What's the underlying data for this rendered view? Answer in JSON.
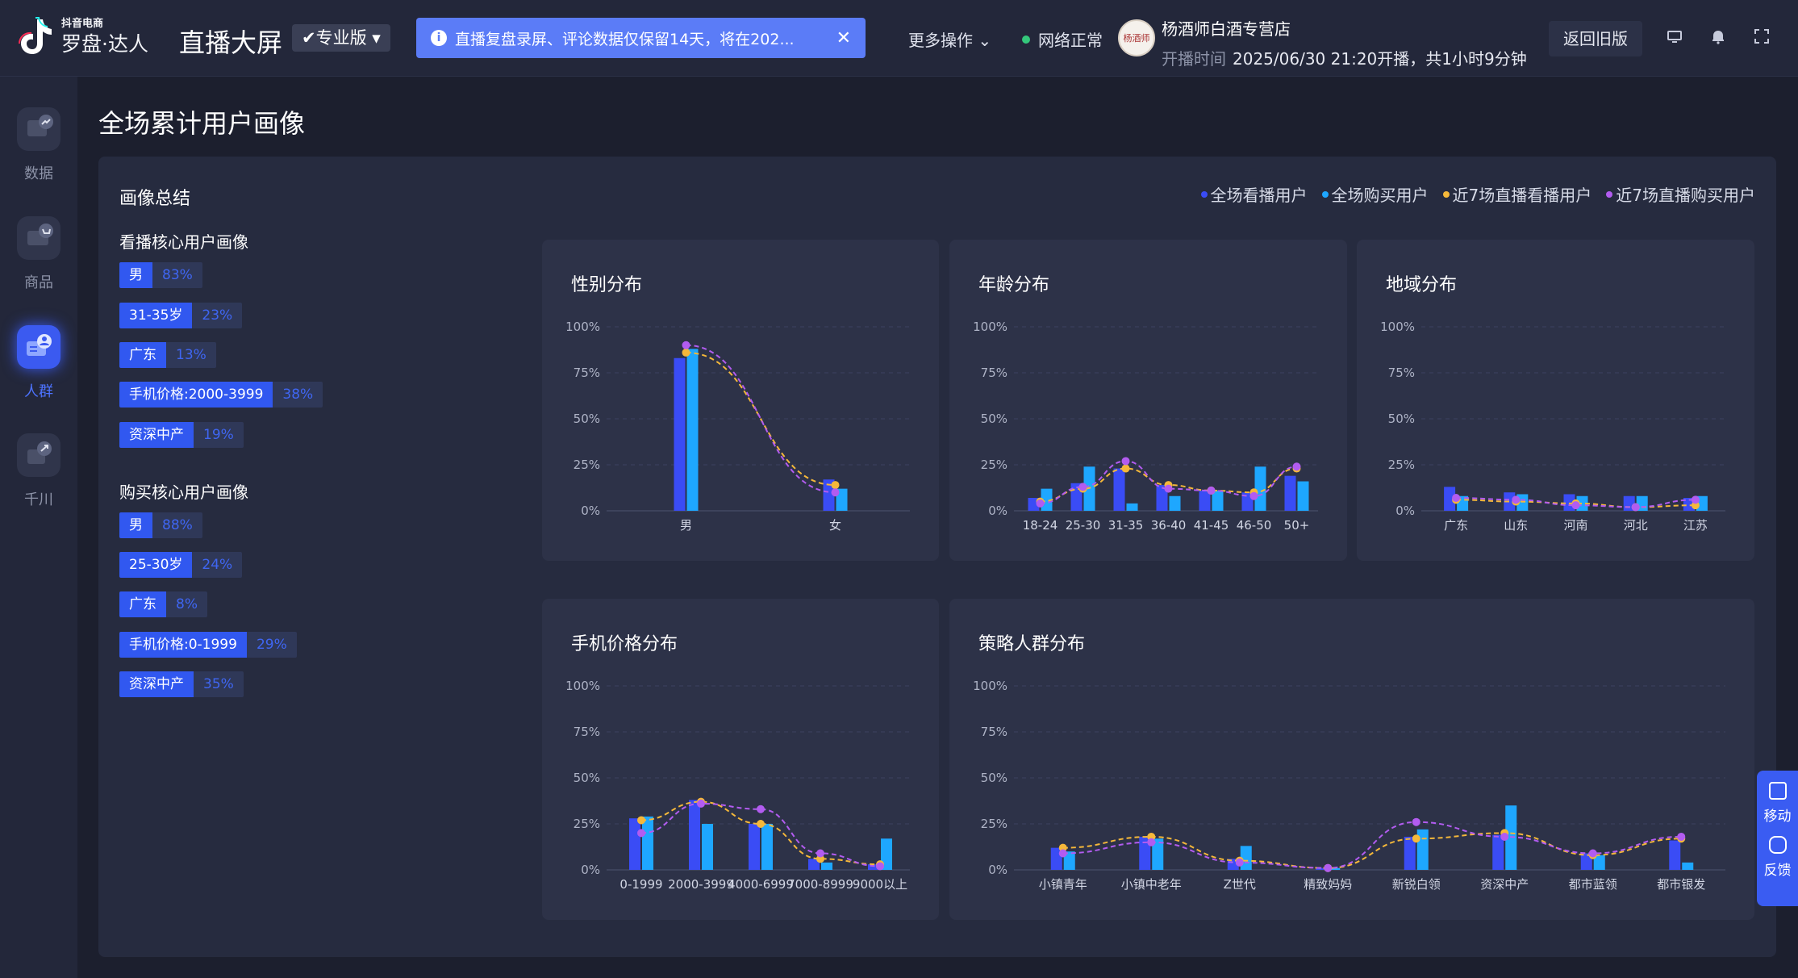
{
  "header": {
    "logo_small": "抖音电商",
    "logo_big": "罗盘·达人",
    "screen_title": "直播大屏",
    "edition": "专业版",
    "notice": "直播复盘录屏、评论数据仅保留14天，将在202...",
    "more_ops": "更多操作",
    "network_status": "网络正常",
    "store_name": "杨酒师白酒专营店",
    "start_label": "开播时间",
    "start_value": "2025/06/30 21:20开播，共1小时9分钟",
    "back_button": "返回旧版",
    "icons": [
      "monitor-icon",
      "bell-icon",
      "fullscreen-icon"
    ]
  },
  "nav": {
    "items": [
      {
        "label": "数据",
        "icon": "data-icon"
      },
      {
        "label": "商品",
        "icon": "cart-icon"
      },
      {
        "label": "人群",
        "icon": "user-group-icon",
        "active": true
      },
      {
        "label": "千川",
        "icon": "qianchuan-icon"
      }
    ]
  },
  "page_title": "全场累计用户画像",
  "summary": {
    "title": "画像总结",
    "legend": [
      "全场看播用户",
      "全场购买用户",
      "近7场直播看播用户",
      "近7场直播购买用户"
    ],
    "watch_title": "看播核心用户画像",
    "watch_tags": [
      {
        "k": "男",
        "v": "83%"
      },
      {
        "k": "31-35岁",
        "v": "23%"
      },
      {
        "k": "广东",
        "v": "13%"
      },
      {
        "k": "手机价格:2000-3999",
        "v": "38%"
      },
      {
        "k": "资深中产",
        "v": "19%"
      }
    ],
    "buy_title": "购买核心用户画像",
    "buy_tags": [
      {
        "k": "男",
        "v": "88%"
      },
      {
        "k": "25-30岁",
        "v": "24%"
      },
      {
        "k": "广东",
        "v": "8%"
      },
      {
        "k": "手机价格:0-1999",
        "v": "29%"
      },
      {
        "k": "资深中产",
        "v": "35%"
      }
    ]
  },
  "colors": {
    "watch": "#3a4cf5",
    "buy": "#1ea7ff",
    "recent_watch": "#f5b83a",
    "recent_buy": "#b25cf0"
  },
  "float_tool": {
    "mobile": "移动",
    "feedback": "反馈"
  },
  "chart_data": [
    {
      "type": "bar",
      "title": "性别分布",
      "categories": [
        "男",
        "女"
      ],
      "ylim": [
        0,
        100
      ],
      "yticks": [
        "100%",
        "75%",
        "50%",
        "25%",
        "0%"
      ],
      "series": [
        {
          "name": "全场看播用户",
          "values": [
            83,
            17
          ]
        },
        {
          "name": "全场购买用户",
          "values": [
            88,
            12
          ]
        },
        {
          "name": "近7场直播看播用户",
          "values": [
            86,
            14
          ]
        },
        {
          "name": "近7场直播购买用户",
          "values": [
            90,
            10
          ]
        }
      ]
    },
    {
      "type": "bar",
      "title": "年龄分布",
      "categories": [
        "18-24",
        "25-30",
        "31-35",
        "36-40",
        "41-45",
        "46-50",
        "50+"
      ],
      "ylim": [
        0,
        100
      ],
      "yticks": [
        "100%",
        "75%",
        "50%",
        "25%",
        "0%"
      ],
      "series": [
        {
          "name": "全场看播用户",
          "values": [
            7,
            15,
            23,
            14,
            11,
            10,
            19
          ]
        },
        {
          "name": "全场购买用户",
          "values": [
            12,
            24,
            4,
            8,
            11,
            24,
            16
          ]
        },
        {
          "name": "近7场直播看播用户",
          "values": [
            5,
            12,
            23,
            14,
            11,
            10,
            23
          ]
        },
        {
          "name": "近7场直播购买用户",
          "values": [
            4,
            13,
            27,
            12,
            11,
            8,
            24
          ]
        }
      ]
    },
    {
      "type": "bar",
      "title": "地域分布",
      "categories": [
        "广东",
        "山东",
        "河南",
        "河北",
        "江苏"
      ],
      "ylim": [
        0,
        100
      ],
      "yticks": [
        "100%",
        "75%",
        "50%",
        "25%",
        "0%"
      ],
      "series": [
        {
          "name": "全场看播用户",
          "values": [
            13,
            10,
            9,
            8,
            7
          ]
        },
        {
          "name": "全场购买用户",
          "values": [
            8,
            9,
            8,
            8,
            8
          ]
        },
        {
          "name": "近7场直播看播用户",
          "values": [
            6,
            5,
            4,
            2,
            3
          ]
        },
        {
          "name": "近7场直播购买用户",
          "values": [
            7,
            6,
            3,
            2,
            6
          ]
        }
      ]
    },
    {
      "type": "bar",
      "title": "手机价格分布",
      "categories": [
        "0-1999",
        "2000-3999",
        "4000-6999",
        "7000-8999",
        "9000以上"
      ],
      "ylim": [
        0,
        100
      ],
      "yticks": [
        "100%",
        "75%",
        "50%",
        "25%",
        "0%"
      ],
      "series": [
        {
          "name": "全场看播用户",
          "values": [
            28,
            38,
            25,
            6,
            3
          ]
        },
        {
          "name": "全场购买用户",
          "values": [
            29,
            25,
            25,
            4,
            17
          ]
        },
        {
          "name": "近7场直播看播用户",
          "values": [
            27,
            37,
            25,
            6,
            3
          ]
        },
        {
          "name": "近7场直播购买用户",
          "values": [
            20,
            36,
            33,
            9,
            2
          ]
        }
      ]
    },
    {
      "type": "bar",
      "title": "策略人群分布",
      "categories": [
        "小镇青年",
        "小镇中老年",
        "Z世代",
        "精致妈妈",
        "新锐白领",
        "资深中产",
        "都市蓝领",
        "都市银发"
      ],
      "ylim": [
        0,
        100
      ],
      "yticks": [
        "100%",
        "75%",
        "50%",
        "25%",
        "0%"
      ],
      "series": [
        {
          "name": "全场看播用户",
          "values": [
            12,
            18,
            6,
            1,
            18,
            19,
            9,
            16
          ]
        },
        {
          "name": "全场购买用户",
          "values": [
            10,
            17,
            13,
            1,
            22,
            35,
            8,
            4
          ]
        },
        {
          "name": "近7场直播看播用户",
          "values": [
            12,
            18,
            5,
            1,
            17,
            20,
            8,
            17
          ]
        },
        {
          "name": "近7场直播购买用户",
          "values": [
            9,
            15,
            4,
            1,
            26,
            18,
            9,
            18
          ]
        }
      ]
    }
  ]
}
